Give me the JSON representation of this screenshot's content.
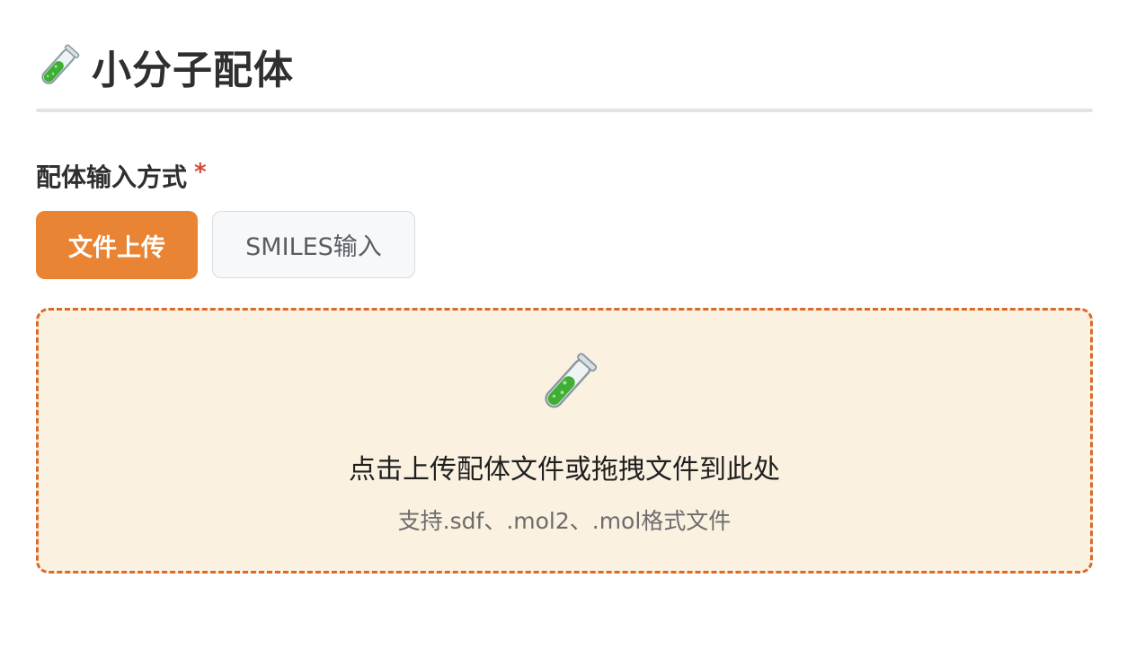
{
  "header": {
    "icon": "test-tube-icon",
    "title": "小分子配体"
  },
  "form": {
    "label": "配体输入方式",
    "required_mark": "*",
    "options": [
      {
        "label": "文件上传",
        "selected": true
      },
      {
        "label": "SMILES输入",
        "selected": false
      }
    ]
  },
  "upload": {
    "icon": "test-tube-icon",
    "main_text": "点击上传配体文件或拖拽文件到此处",
    "hint_text": "支持.sdf、.mol2、.mol格式文件"
  },
  "colors": {
    "accent": "#e88433",
    "dropzone_border": "#d86a2c",
    "dropzone_bg": "#fbf1e1",
    "required": "#d14b3f"
  }
}
